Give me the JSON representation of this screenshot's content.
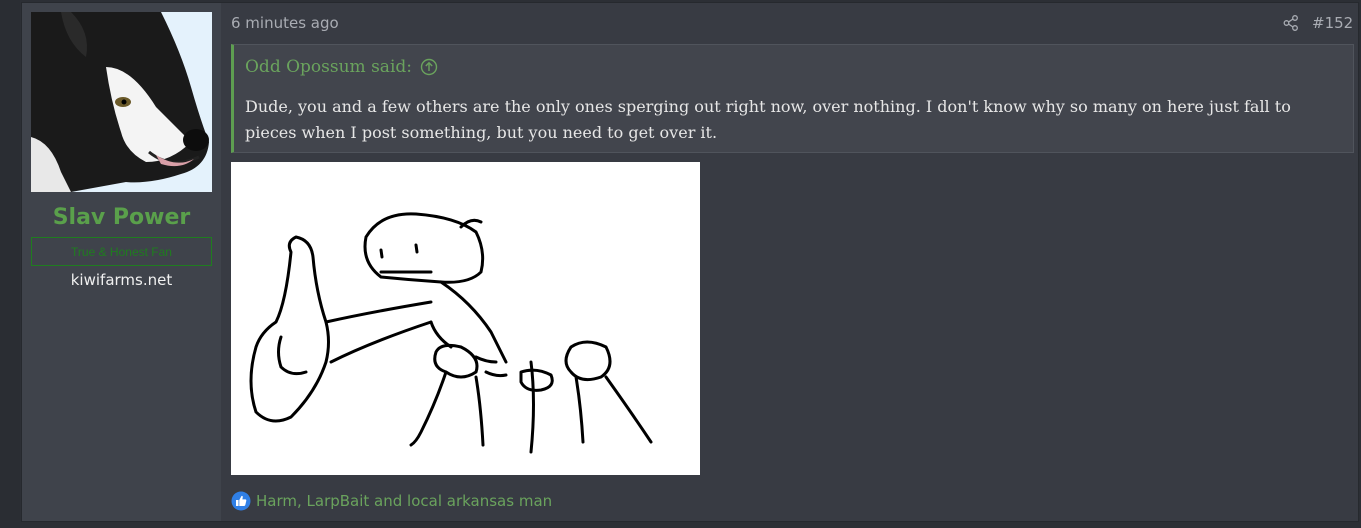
{
  "post": {
    "timestamp": "6 minutes ago",
    "number": "#152",
    "share_icon": "share-icon"
  },
  "user": {
    "name": "Slav Power",
    "title": "True & Honest Fan",
    "site": "kiwifarms.net",
    "name_color": "#5aa04b"
  },
  "quote": {
    "author": "Odd Opossum said:",
    "text": "Dude, you and a few others are the only ones sperging out right now, over nothing. I don't know why so many on here just fall to pieces when I post something, but you need to get over it.",
    "accent_color": "#5e9e51"
  },
  "reactions": {
    "icon": "like-icon",
    "text": "Harm, LarpBait and local arkansas man"
  }
}
